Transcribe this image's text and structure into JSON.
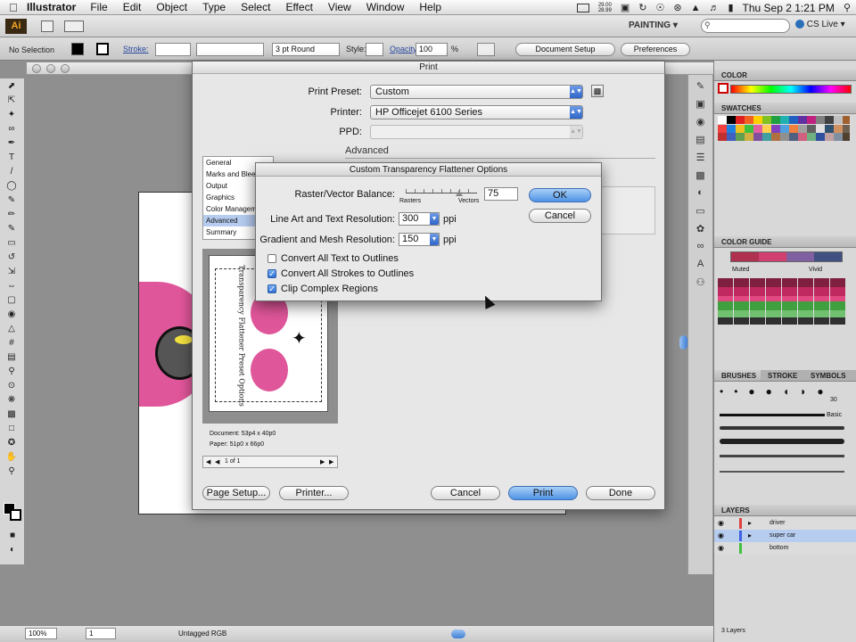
{
  "menubar": {
    "app": "Illustrator",
    "items": [
      "File",
      "Edit",
      "Object",
      "Type",
      "Select",
      "Effect",
      "View",
      "Window",
      "Help"
    ],
    "mem_top": "29.00",
    "mem_bot": "28.99",
    "clock": "Thu Sep 2  1:21 PM"
  },
  "appbar": {
    "workspace": "PAINTING",
    "cs_live": "CS Live"
  },
  "control": {
    "selection": "No Selection",
    "stroke_label": "Stroke:",
    "brush": "3 pt Round",
    "style_label": "Style:",
    "opacity_label": "Opacity:",
    "opacity_value": "100",
    "percent": "%",
    "doc_setup": "Document Setup",
    "preferences": "Preferences"
  },
  "statusbar": {
    "zoom": "100%",
    "page": "1",
    "color_mode": "Untagged RGB"
  },
  "print_dialog": {
    "title": "Print",
    "preset_label": "Print Preset:",
    "preset_value": "Custom",
    "printer_label": "Printer:",
    "printer_value": "HP Officejet 6100 Series",
    "ppd_label": "PPD:",
    "section": "Advanced",
    "categories": [
      "General",
      "Marks and Bleed",
      "Output",
      "Graphics",
      "Color Management",
      "Advanced",
      "Summary"
    ],
    "selected_category": "Advanced",
    "preview_doc": "Document: 53p4 x 40p0",
    "preview_paper": "Paper: 51p0 x 66p0",
    "preview_page": "1 of 1",
    "preview_art_title": "Transparency Flattener Preset Options",
    "page_setup": "Page Setup...",
    "printer_btn": "Printer...",
    "cancel": "Cancel",
    "print": "Print",
    "done": "Done"
  },
  "flattener": {
    "title": "Custom Transparency Flattener Options",
    "raster_label": "Raster/Vector Balance:",
    "rasters": "Rasters",
    "vectors": "Vectors",
    "raster_value": "75",
    "line_label": "Line Art and Text Resolution:",
    "line_value": "300",
    "gradient_label": "Gradient and Mesh Resolution:",
    "gradient_value": "150",
    "unit": "ppi",
    "check_text": "Convert All Text to Outlines",
    "check_strokes": "Convert All Strokes to Outlines",
    "check_clip": "Clip Complex Regions",
    "ok": "OK",
    "cancel": "Cancel"
  },
  "panels": {
    "color": "COLOR",
    "swatches": "SWATCHES",
    "color_guide": "COLOR GUIDE",
    "muted": "Muted",
    "vivid": "Vivid",
    "brushes": "BRUSHES",
    "stroke": "STROKE",
    "symbols": "SYMBOLS",
    "brush_size": "30",
    "basic": "Basic",
    "layers": "LAYERS",
    "layer_names": [
      "driver",
      "super car",
      "bottom"
    ],
    "layers_count": "3 Layers"
  },
  "colors": {
    "accent_blue": "#4f93e5",
    "selection_blue": "#b6cdf0",
    "pink": "#e0569a"
  }
}
